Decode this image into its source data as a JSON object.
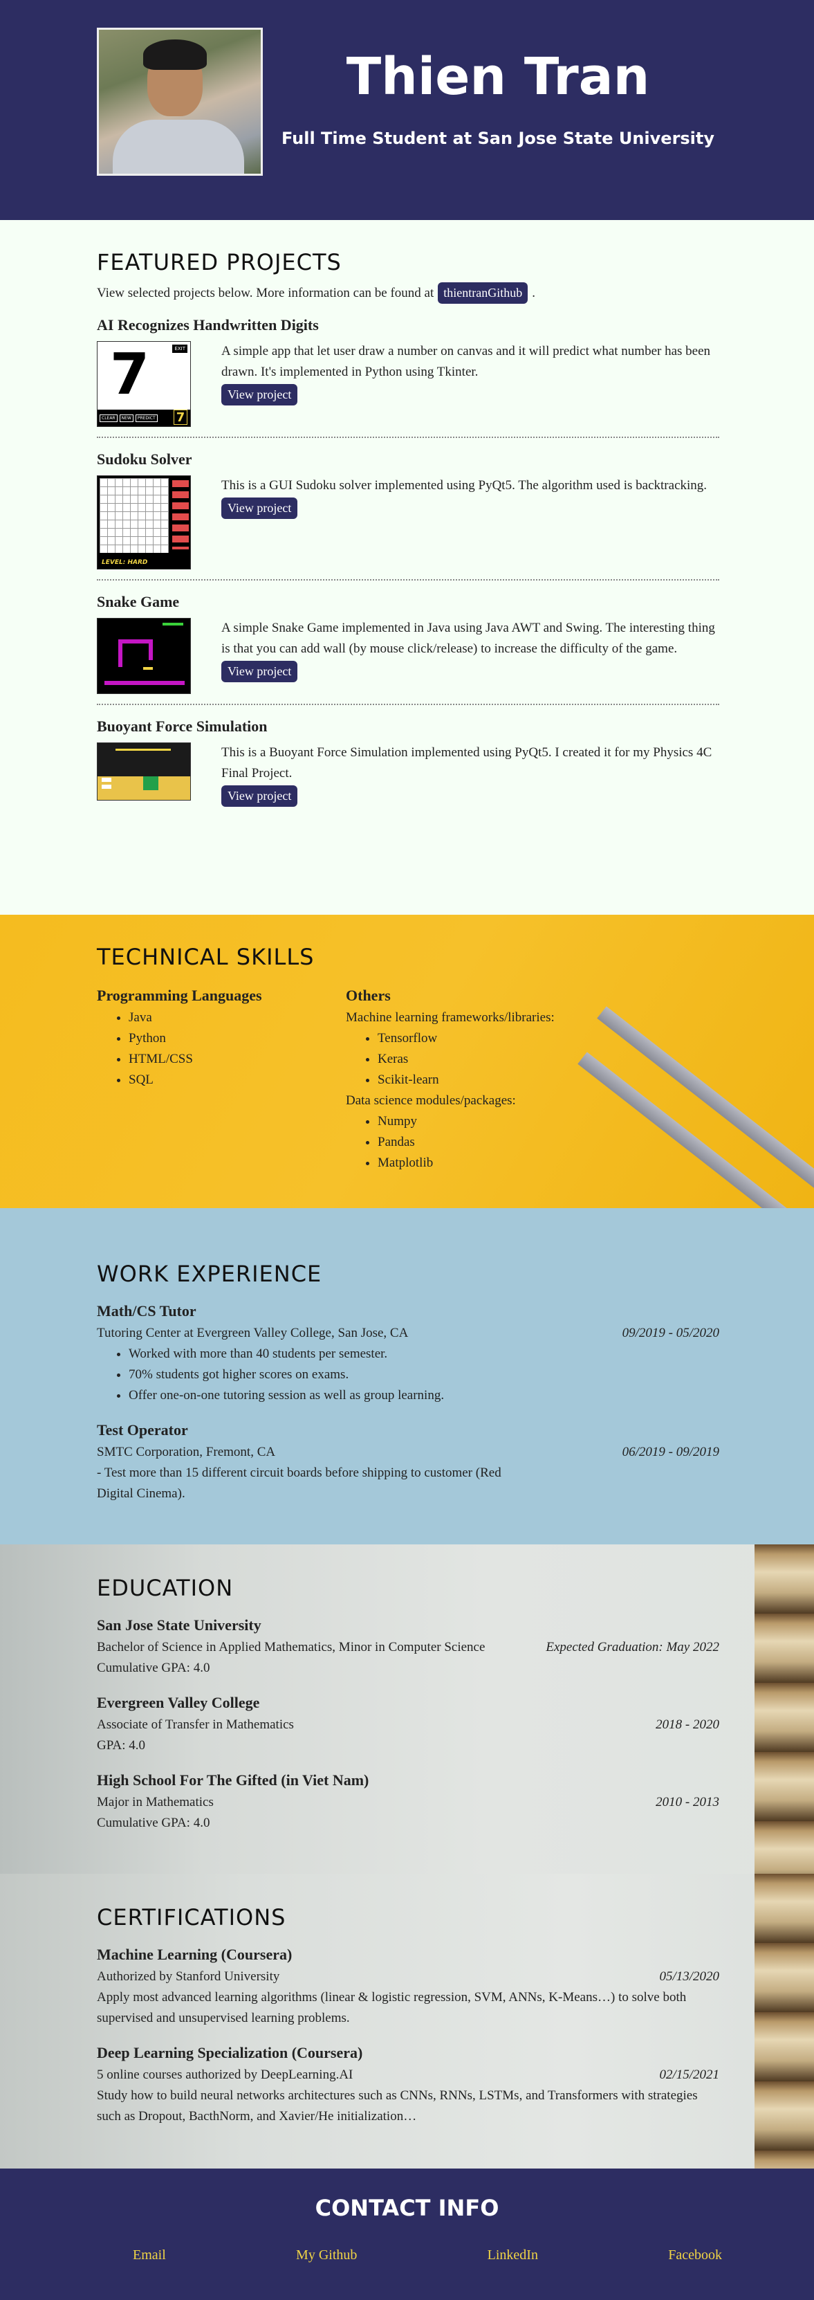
{
  "header": {
    "name": "Thien Tran",
    "tagline": "Full Time Student at San Jose State University"
  },
  "projects": {
    "title": "FEATURED PROJECTS",
    "intro": "View selected projects below. More information can be found at",
    "github_label": "thientranGithub",
    "items": [
      {
        "title": "AI Recognizes Handwritten Digits",
        "description": "A simple app that let user draw a number on canvas and it will predict what number has been drawn. It's implemented in Python using Tkinter.",
        "button": "View project",
        "thumb_digit": "7",
        "thumb_buttons": [
          "CLEAR",
          "NEW",
          "PREDICT"
        ],
        "thumb_exit": "EXIT"
      },
      {
        "title": "Sudoku Solver",
        "description": "This is a GUI Sudoku solver implemented using PyQt5. The algorithm used is backtracking.",
        "button": "View project",
        "thumb_level": "LEVEL: HARD"
      },
      {
        "title": "Snake Game",
        "description": "A simple Snake Game implemented in Java using Java AWT and Swing. The interesting thing is that you can add wall (by mouse click/release) to increase the difficulty of the game.",
        "button": "View project"
      },
      {
        "title": "Buoyant Force Simulation",
        "description": "This is a Buoyant Force Simulation implemented using PyQt5. I created it for my Physics 4C Final Project.",
        "button": "View project"
      }
    ]
  },
  "skills": {
    "title": "TECHNICAL SKILLS",
    "languages_title": "Programming Languages",
    "languages": [
      "Java",
      "Python",
      "HTML/CSS",
      "SQL"
    ],
    "others_title": "Others",
    "ml_label": "Machine learning frameworks/libraries:",
    "ml": [
      "Tensorflow",
      "Keras",
      "Scikit-learn"
    ],
    "ds_label": "Data science modules/packages:",
    "ds": [
      "Numpy",
      "Pandas",
      "Matplotlib"
    ]
  },
  "work": {
    "title": "WORK EXPERIENCE",
    "jobs": [
      {
        "role": "Math/CS Tutor",
        "place": "Tutoring Center at Evergreen Valley College, San Jose, CA",
        "date": "09/2019 - 05/2020",
        "bullets": [
          "Worked with more than 40 students per semester.",
          "70% students got higher scores on exams.",
          "Offer one-on-one tutoring session as well as group learning."
        ]
      },
      {
        "role": "Test Operator",
        "place": "SMTC Corporation, Fremont, CA",
        "date": "06/2019 - 09/2019",
        "text": "- Test more than 15 different circuit boards before shipping to customer (Red Digital Cinema)."
      }
    ]
  },
  "education": {
    "title": "EDUCATION",
    "items": [
      {
        "school": "San Jose State University",
        "degree": "Bachelor of Science in Applied Mathematics, Minor in Computer Science",
        "date": "Expected Graduation: May 2022",
        "gpa": "Cumulative GPA: 4.0"
      },
      {
        "school": "Evergreen Valley College",
        "degree": "Associate of Transfer in Mathematics",
        "date": "2018 - 2020",
        "gpa": "GPA: 4.0"
      },
      {
        "school": "High School For The Gifted (in Viet Nam)",
        "degree": "Major in Mathematics",
        "date": "2010 - 2013",
        "gpa": "Cumulative GPA: 4.0"
      }
    ]
  },
  "certs": {
    "title": "CERTIFICATIONS",
    "items": [
      {
        "name": "Machine Learning (Coursera)",
        "by": "Authorized by Stanford University",
        "date": "05/13/2020",
        "text": "Apply most advanced learning algorithms (linear & logistic regression, SVM, ANNs, K-Means…) to solve both supervised and unsupervised learning problems."
      },
      {
        "name": "Deep Learning Specialization (Coursera)",
        "by": "5 online courses authorized by DeepLearning.AI",
        "date": "02/15/2021",
        "text": "Study how to build neural networks architectures such as CNNs, RNNs, LSTMs, and Transformers with strategies such as Dropout, BacthNorm, and Xavier/He initialization…"
      }
    ]
  },
  "contact": {
    "title": "CONTACT INFO",
    "links": [
      "Email",
      "My Github",
      "LinkedIn",
      "Facebook"
    ]
  },
  "colors": {
    "navy": "#2d2d62",
    "mint": "#f6fff6",
    "yellow": "#f5bc1f",
    "blue": "#a4c8d9",
    "link": "#f1d545"
  }
}
